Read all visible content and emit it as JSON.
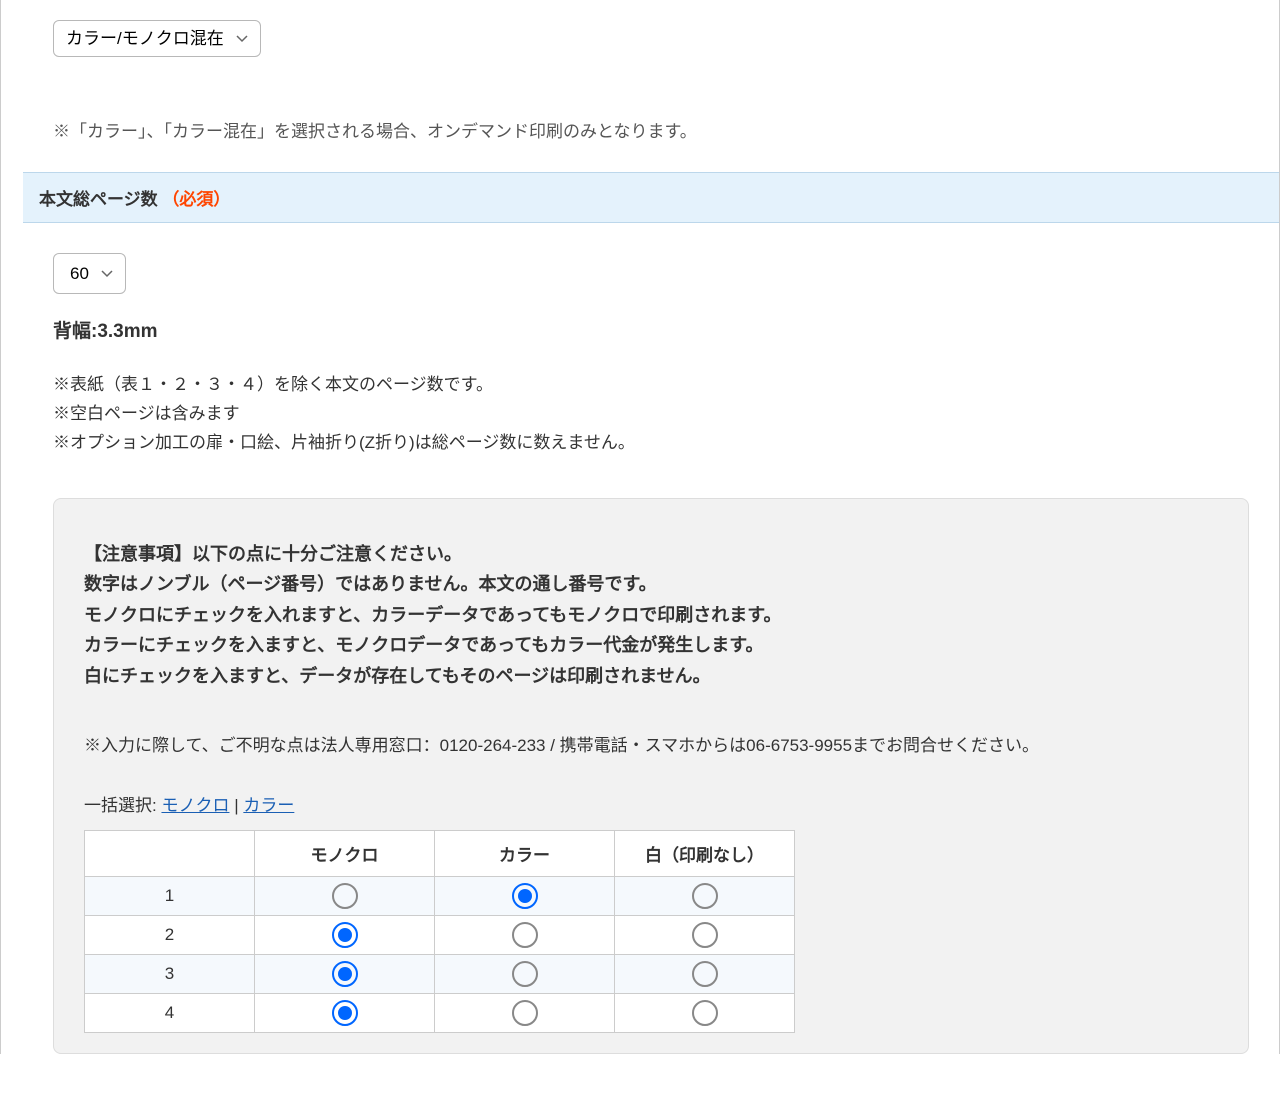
{
  "colorMode": {
    "selected": "カラー/モノクロ混在",
    "note": "※「カラー」、「カラー混在」を選択される場合、オンデマンド印刷のみとなります。"
  },
  "pageSection": {
    "title": "本文総ページ数",
    "requiredLabel": "（必須）",
    "pageCount": "60",
    "spine": "背幅:3.3mm",
    "notes": [
      "※表紙（表１・２・３・４）を除く本文のページ数です。",
      "※空白ページは含みます",
      "※オプション加工の扉・口絵、片袖折り(Z折り)は総ページ数に数えません。"
    ]
  },
  "caution": {
    "lines": [
      "【注意事項】以下の点に十分ご注意ください。",
      "数字はノンブル（ページ番号）ではありません。本文の通し番号です。",
      "モノクロにチェックを入れますと、カラーデータであってもモノクロで印刷されます。",
      "カラーにチェックを入ますと、モノクロデータであってもカラー代金が発生します。",
      "白にチェックを入ますと、データが存在してもそのページは印刷されません。"
    ],
    "contact": "※入力に際して、ご不明な点は法人専用窓口：0120-264-233 / 携帯電話・スマホからは06-6753-9955までお問合せください。"
  },
  "bulkSelect": {
    "label": "一括選択:",
    "mono": "モノクロ",
    "separator": " | ",
    "color": "カラー"
  },
  "table": {
    "headers": {
      "num": "",
      "mono": "モノクロ",
      "color": "カラー",
      "white": "白（印刷なし）"
    },
    "rows": [
      {
        "num": "1",
        "selected": "color"
      },
      {
        "num": "2",
        "selected": "mono"
      },
      {
        "num": "3",
        "selected": "mono"
      },
      {
        "num": "4",
        "selected": "mono"
      }
    ]
  }
}
